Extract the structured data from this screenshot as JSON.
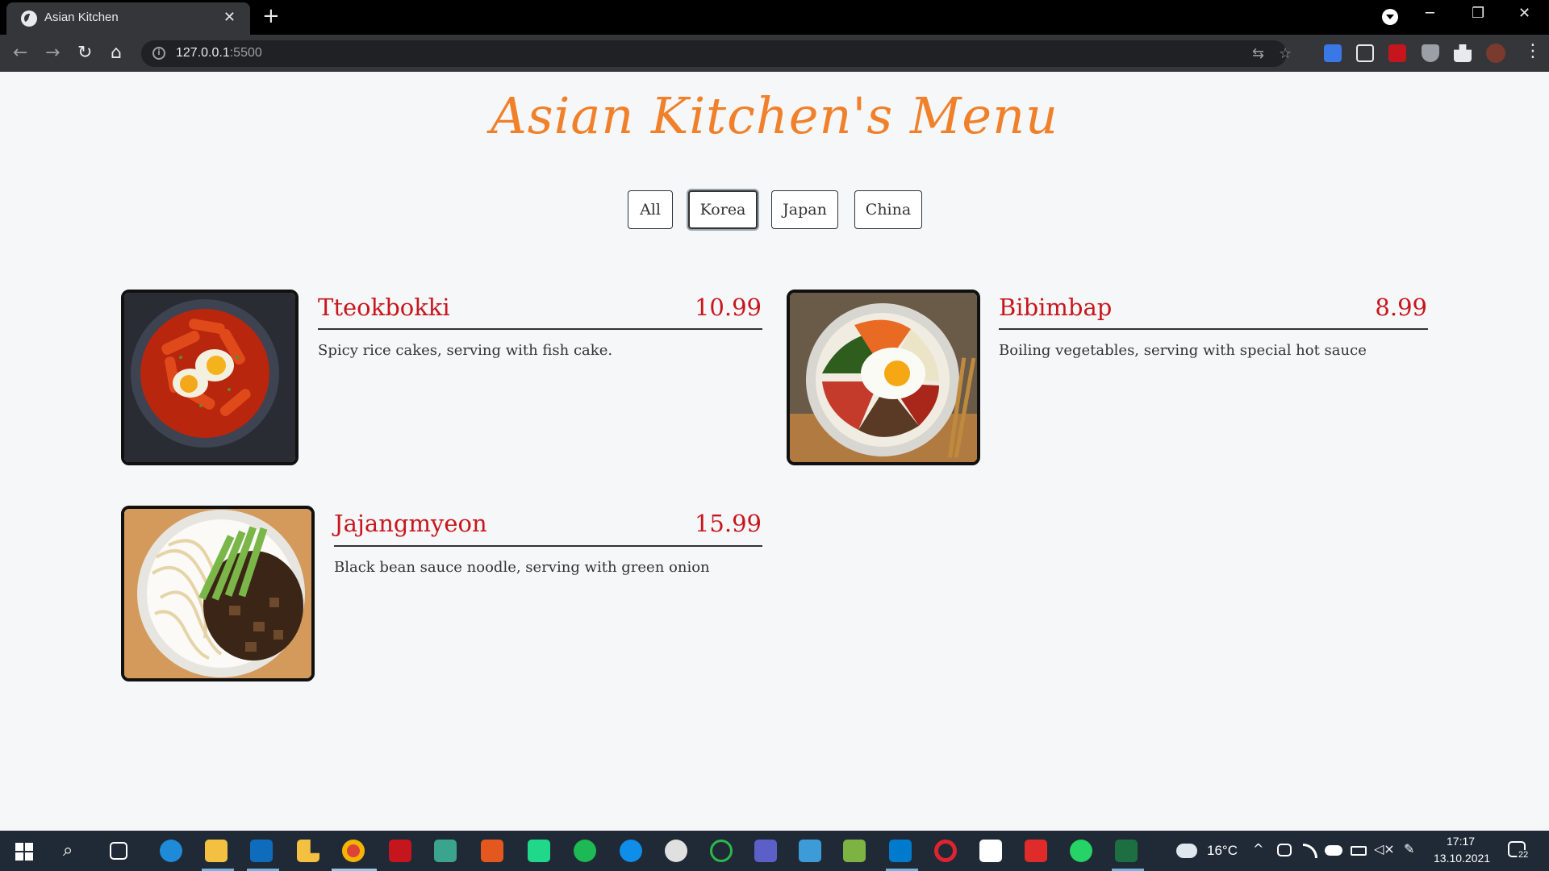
{
  "browser": {
    "tab_title": "Asian Kitchen",
    "tab_close": "✕",
    "new_tab": "+",
    "url_host": "127.0.0.1",
    "url_port": ":5500",
    "minimize": "─",
    "restore": "❐",
    "close": "✕",
    "back": "←",
    "forward": "→",
    "reload": "↻",
    "home": "⌂",
    "info": "i",
    "translate": "⇆",
    "star": "☆",
    "menu": "⋮"
  },
  "page": {
    "title": "Asian Kitchen's Menu",
    "filters": [
      {
        "label": "All"
      },
      {
        "label": "Korea"
      },
      {
        "label": "Japan"
      },
      {
        "label": "China"
      }
    ],
    "active_filter": "Korea",
    "items": [
      {
        "name": "Tteokbokki",
        "price": "10.99",
        "description": "Spicy rice cakes, serving with fish cake."
      },
      {
        "name": "Bibimbap",
        "price": "8.99",
        "description": "Boiling vegetables, serving with special hot sauce"
      },
      {
        "name": "Jajangmyeon",
        "price": "15.99",
        "description": "Black bean sauce noodle, serving with green onion"
      }
    ]
  },
  "taskbar": {
    "temperature": "16°C",
    "time": "17:17",
    "date": "13.10.2021",
    "notifications": "22",
    "search_icon": "⌕",
    "start_icon": "windows-logo"
  }
}
